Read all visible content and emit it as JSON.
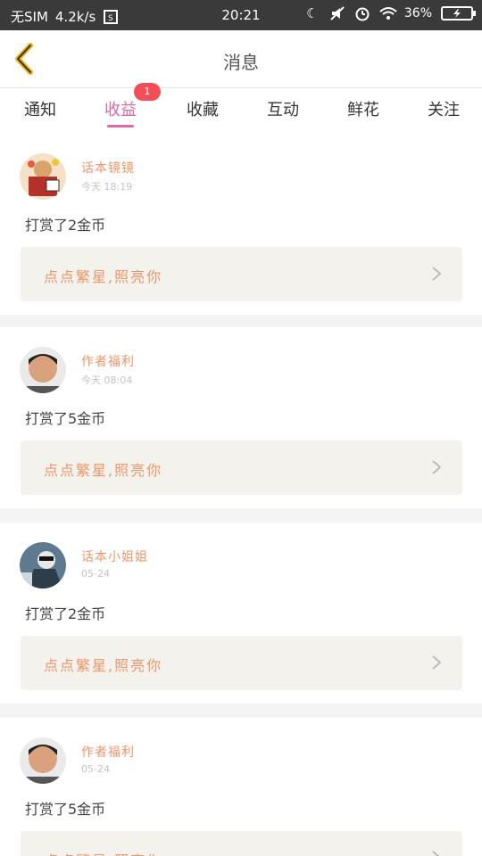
{
  "status_bar": {
    "carrier": "无SIM",
    "speed": "4.2k/s",
    "time": "20:21",
    "battery": "36%"
  },
  "header": {
    "title": "消息",
    "back_icon": "chevron-left-icon"
  },
  "tabs": [
    {
      "label": "通知",
      "active": false
    },
    {
      "label": "收益",
      "active": true
    },
    {
      "label": "收藏",
      "active": false
    },
    {
      "label": "互动",
      "active": false
    },
    {
      "label": "鲜花",
      "active": false
    },
    {
      "label": "关注",
      "active": false
    }
  ],
  "tab_badge": "1",
  "colors": {
    "accent": "#e06aa0",
    "name": "#f0956a",
    "badge": "#f24e57",
    "reply_bg": "#f3f2ec"
  },
  "messages": [
    {
      "name": "话本镜镜",
      "time": "今天 18:19",
      "text": "打赏了2金币",
      "reply": "点点繁星,照亮你"
    },
    {
      "name": "作者福利",
      "time": "今天 08:04",
      "text": "打赏了5金币",
      "reply": "点点繁星,照亮你"
    },
    {
      "name": "话本小姐姐",
      "time": "05-24",
      "text": "打赏了2金币",
      "reply": "点点繁星,照亮你"
    },
    {
      "name": "作者福利",
      "time": "05-24",
      "text": "打赏了5金币",
      "reply": "点点繁星,照亮你"
    }
  ]
}
